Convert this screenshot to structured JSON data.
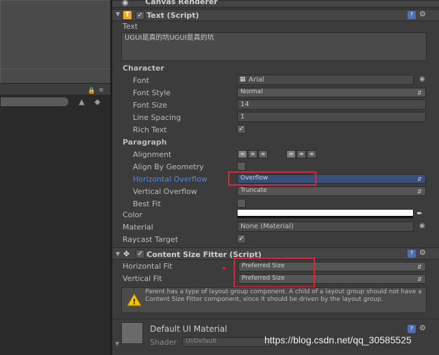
{
  "inspector": {
    "canvas_renderer_title": "Canvas Renderer",
    "text_component": {
      "title": "Text (Script)",
      "text_label": "Text",
      "text_value": "UGUI是真的坑UGUI是真的坑",
      "character_section": "Character",
      "font_label": "Font",
      "font_value": "Arial",
      "font_style_label": "Font Style",
      "font_style_value": "Normal",
      "font_size_label": "Font Size",
      "font_size_value": "14",
      "line_spacing_label": "Line Spacing",
      "line_spacing_value": "1",
      "rich_text_label": "Rich Text",
      "rich_text_checked": true,
      "paragraph_section": "Paragraph",
      "alignment_label": "Alignment",
      "align_by_geometry_label": "Align By Geometry",
      "align_by_geometry_checked": false,
      "horizontal_overflow_label": "Horizontal Overflow",
      "horizontal_overflow_value": "Overflow",
      "vertical_overflow_label": "Vertical Overflow",
      "vertical_overflow_value": "Truncate",
      "best_fit_label": "Best Fit",
      "best_fit_checked": false,
      "color_label": "Color",
      "color_value": "#ffffff",
      "material_label": "Material",
      "material_value": "None (Material)",
      "raycast_target_label": "Raycast Target",
      "raycast_target_checked": true
    },
    "content_size_fitter": {
      "title": "Content Size Fitter (Script)",
      "horizontal_fit_label": "Horizontal Fit",
      "horizontal_fit_value": "Preferred Size",
      "vertical_fit_label": "Vertical Fit",
      "vertical_fit_value": "Preferred Size",
      "warning_text": "Parent has a type of layout group component. A child of a layout group should not have a Content Size Fitter component, since it should be driven by the layout group."
    },
    "material_block": {
      "title": "Default UI Material",
      "shader_label": "Shader",
      "shader_value": "UI/Default"
    }
  },
  "watermark": "https://blog.csdn.net/qq_30585525",
  "colors": {
    "highlight_red": "#e0243a",
    "label_blue": "#4f86e8",
    "warning_yellow": "#f5c400"
  }
}
